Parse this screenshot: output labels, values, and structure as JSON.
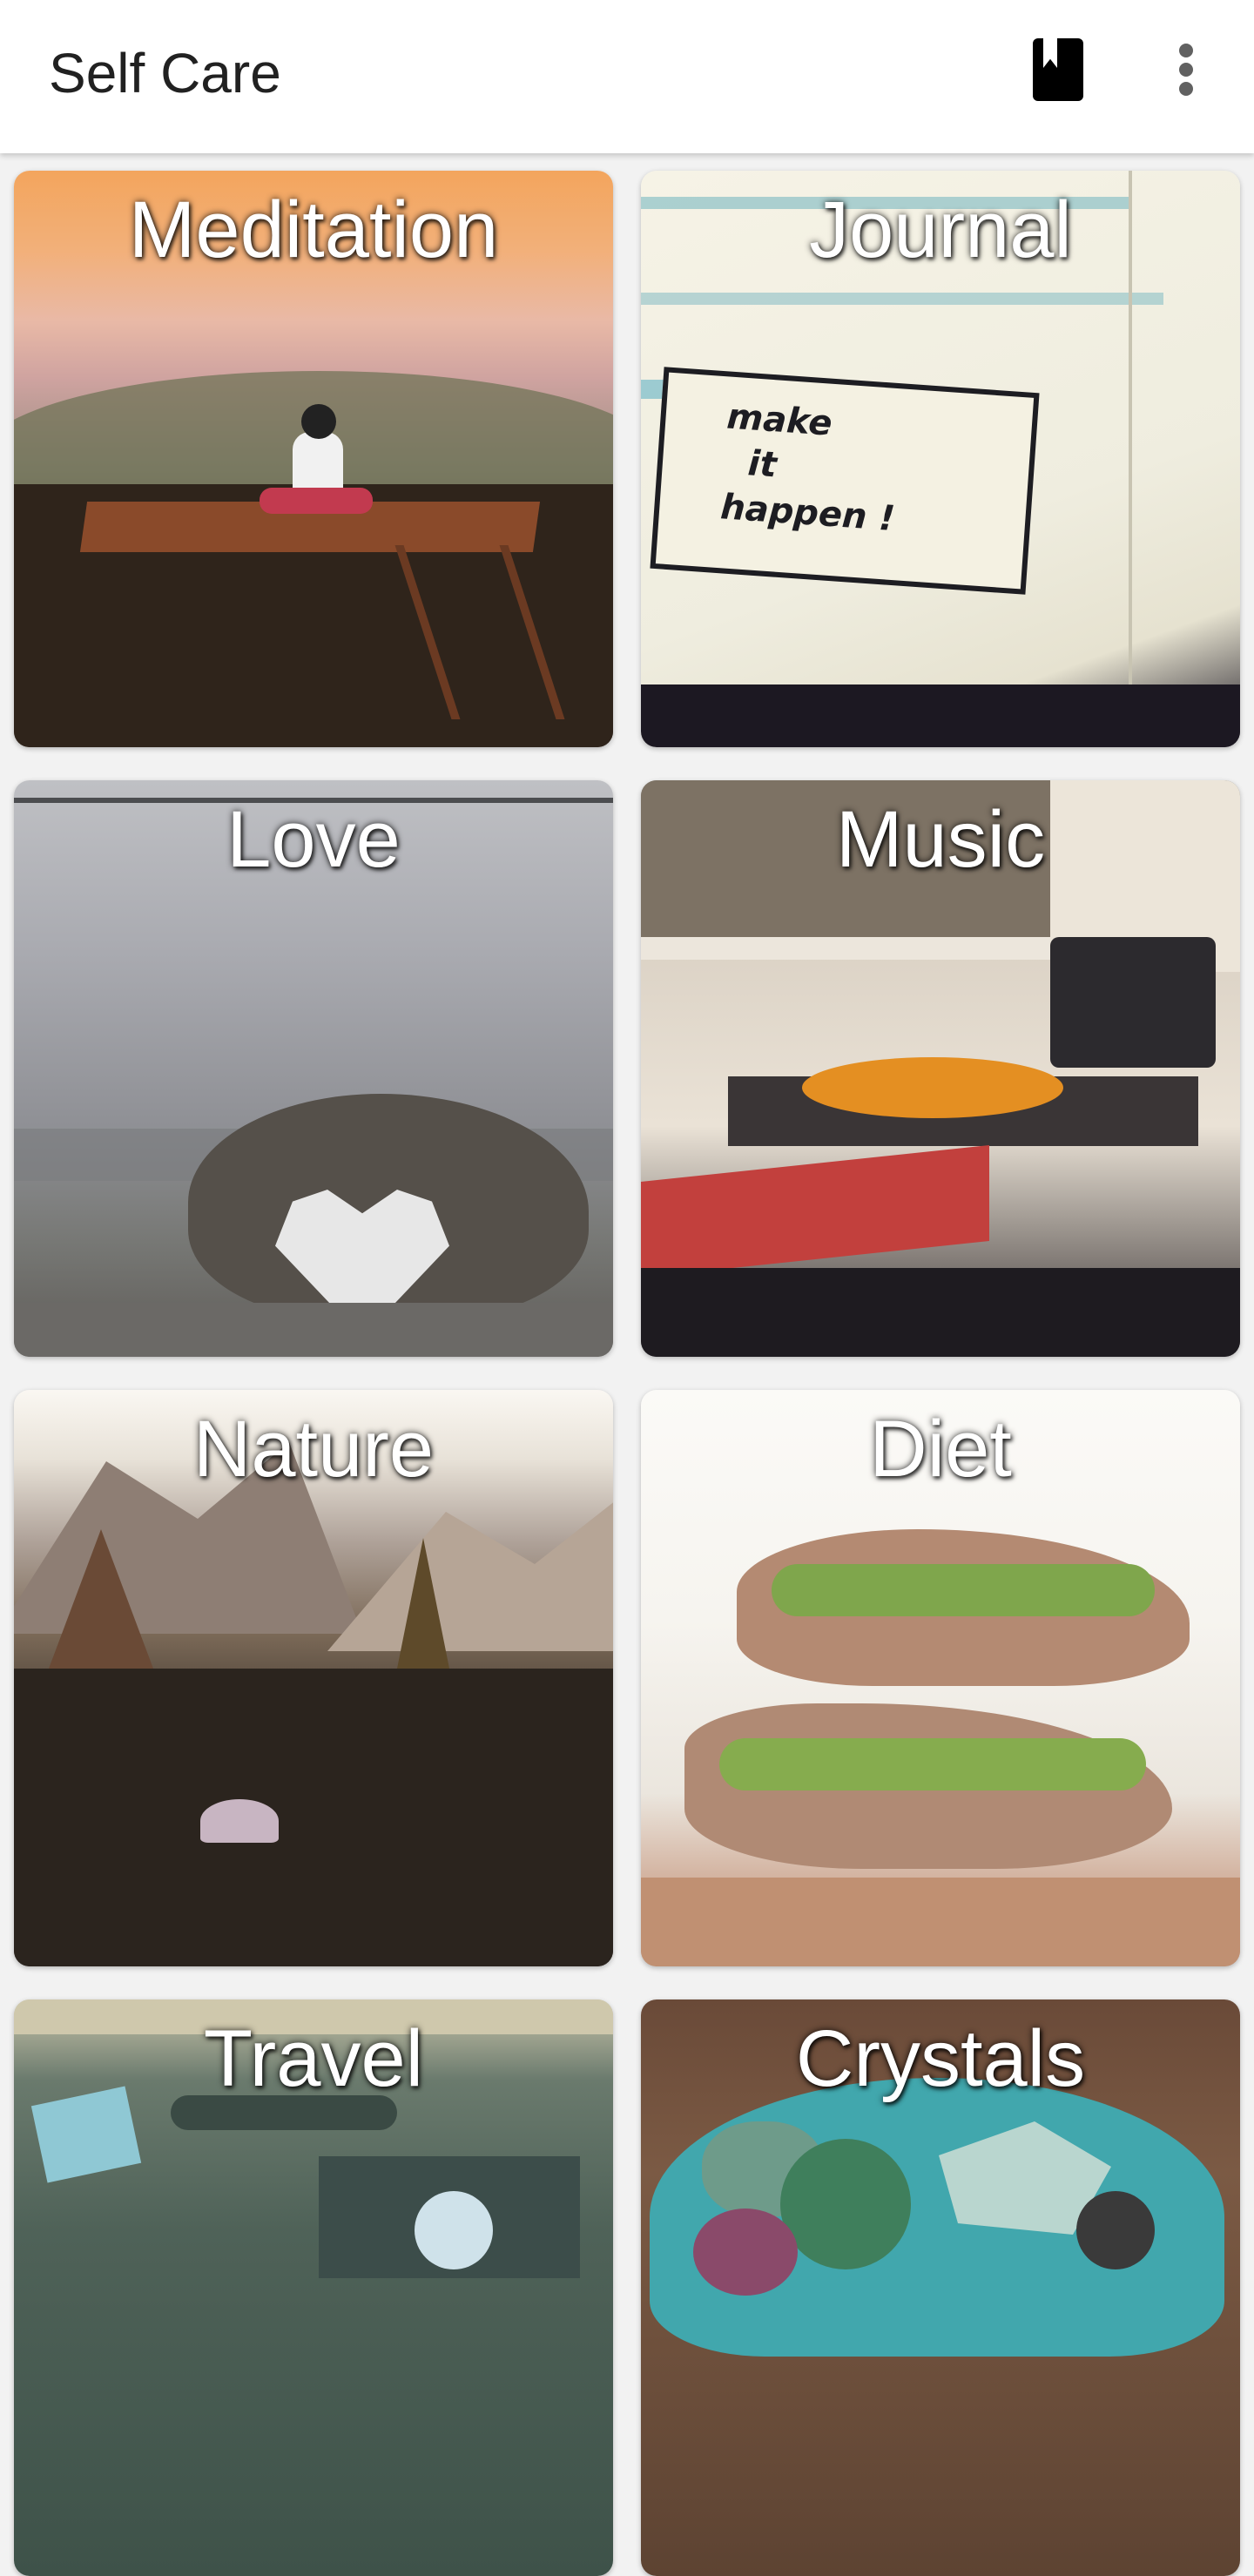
{
  "app_bar": {
    "title": "Self Care",
    "actions": [
      {
        "icon": "bookmark-icon"
      },
      {
        "icon": "more-vert-icon"
      }
    ]
  },
  "categories": [
    {
      "label": "Meditation"
    },
    {
      "label": "Journal"
    },
    {
      "label": "Love"
    },
    {
      "label": "Music"
    },
    {
      "label": "Nature"
    },
    {
      "label": "Diet"
    },
    {
      "label": "Travel"
    },
    {
      "label": "Crystals"
    }
  ],
  "colors": {
    "app_bar_background": "#ffffff",
    "title_text": "#212121",
    "tile_label_text": "#ffffff",
    "screen_background": "#f2f2f2"
  }
}
